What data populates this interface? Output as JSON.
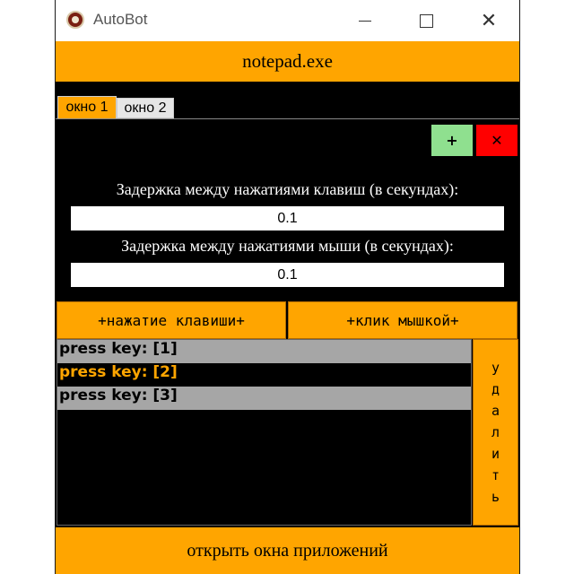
{
  "window": {
    "title": "AutoBot",
    "icon": "app-logo-icon",
    "minimize_icon": "minimize-icon",
    "maximize_icon": "maximize-icon",
    "close_glyph": "✕"
  },
  "target": {
    "label": "notepad.exe"
  },
  "tabs": [
    {
      "label": "окно 1",
      "active": true
    },
    {
      "label": "окно 2",
      "active": false
    }
  ],
  "tab_controls": {
    "add_label": "+",
    "delete_label": "✕"
  },
  "delays": {
    "key_label": "Задержка между нажатиями клавиш (в секундах):",
    "key_value": "0.1",
    "mouse_label": "Задержка между нажатиями мыши (в секундах):",
    "mouse_value": "0.1"
  },
  "actions": {
    "add_key_label": "+нажатие клавиши+",
    "add_click_label": "+клик мышкой+"
  },
  "sequence": [
    {
      "text": "press key: [1]",
      "selected": false
    },
    {
      "text": "press key: [2]",
      "selected": true
    },
    {
      "text": "press key: [3]",
      "selected": false
    }
  ],
  "delete_vertical": [
    "у",
    "д",
    "а",
    "л",
    "и",
    "т",
    "ь"
  ],
  "footer": {
    "open_windows_label": "открыть окна приложений"
  },
  "colors": {
    "accent": "#ffa500",
    "background": "#000000",
    "list_item": "#a6a6a6",
    "add": "#8fe08f",
    "delete": "#ff0000"
  }
}
